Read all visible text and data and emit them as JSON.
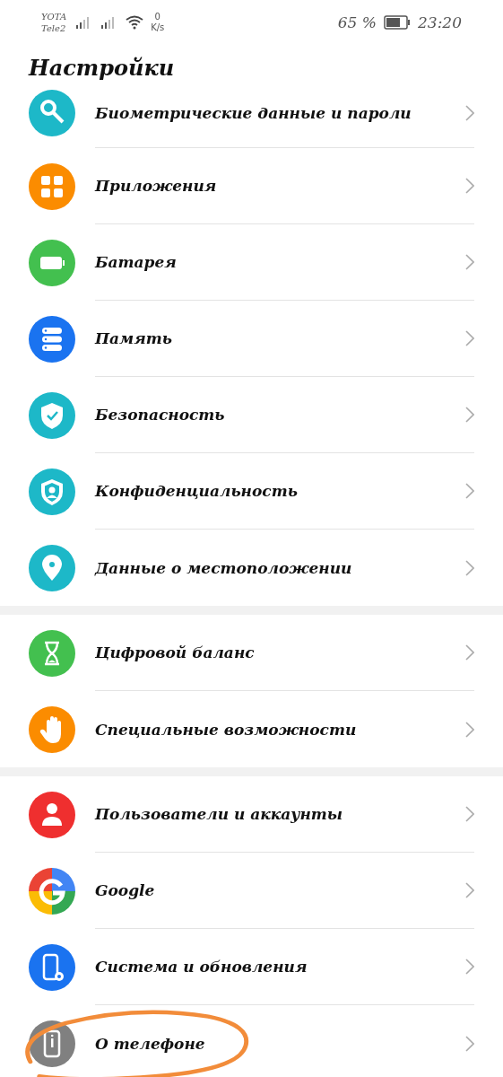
{
  "status_bar": {
    "carriers": [
      "YOTA",
      "Tele2"
    ],
    "speed_value": "0",
    "speed_unit": "K/s",
    "battery_percent": "65 %",
    "time": "23:20"
  },
  "title": "Настройки",
  "groups": [
    {
      "items": [
        {
          "label": "Биометрические данные и пароли",
          "kind": "key",
          "color": "#1db8c8",
          "circled": false
        },
        {
          "label": "Приложения",
          "kind": "apps",
          "color": "#fb8c00",
          "circled": false
        },
        {
          "label": "Батарея",
          "kind": "battery",
          "color": "#43c04f",
          "circled": false
        },
        {
          "label": "Память",
          "kind": "storage",
          "color": "#1a73f0",
          "circled": false
        },
        {
          "label": "Безопасность",
          "kind": "shield",
          "color": "#1db8c8",
          "circled": false
        },
        {
          "label": "Конфиденциальность",
          "kind": "privacy",
          "color": "#1db8c8",
          "circled": false
        },
        {
          "label": "Данные о местоположении",
          "kind": "location",
          "color": "#1db8c8",
          "circled": false
        }
      ]
    },
    {
      "items": [
        {
          "label": "Цифровой баланс",
          "kind": "hourglass",
          "color": "#43c04f",
          "circled": false
        },
        {
          "label": "Специальные возможности",
          "kind": "hand",
          "color": "#fb8c00",
          "circled": false
        }
      ]
    },
    {
      "items": [
        {
          "label": "Пользователи и аккаунты",
          "kind": "user",
          "color": "#ef2f2f",
          "circled": false
        },
        {
          "label": "Google",
          "kind": "google",
          "color": "#4285f4",
          "circled": false
        },
        {
          "label": "Система и обновления",
          "kind": "system",
          "color": "#1a73f0",
          "circled": false
        },
        {
          "label": "О телефоне",
          "kind": "phone",
          "color": "#808080",
          "circled": true
        }
      ]
    }
  ]
}
